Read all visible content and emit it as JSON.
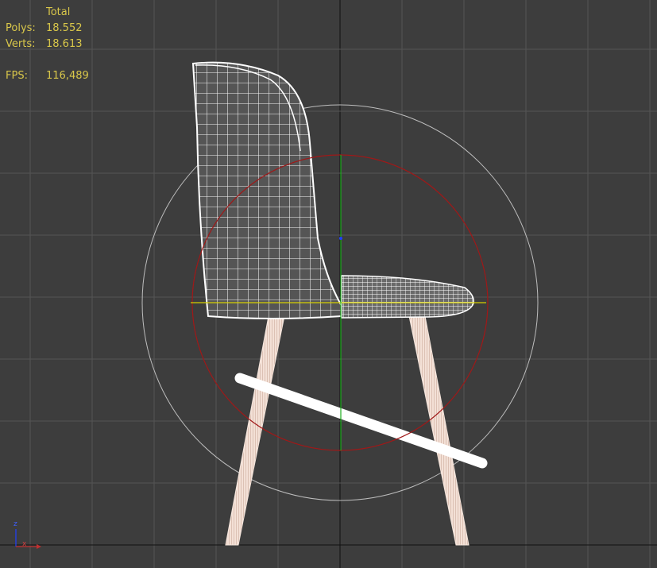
{
  "stats": {
    "header": "Total",
    "rows": [
      {
        "label": "Polys:",
        "value": "18.552"
      },
      {
        "label": "Verts:",
        "value": "18.613"
      }
    ],
    "fps_label": "FPS:",
    "fps_value": "116,489"
  },
  "axis_gizmo": {
    "z_label": "z",
    "x_label": "x"
  },
  "colors": {
    "background": "#3d3d3d",
    "grid": "#555555",
    "grid_axis": "#111111",
    "wireframe": "#ffffff",
    "stats_text": "#d9c74a",
    "rotate_gizmo_outer": "#bdbdbd",
    "rotate_gizmo_inner": "#a01818",
    "gizmo_x": "#d6d000",
    "gizmo_y": "#1fae1f",
    "gizmo_z": "#2040ff"
  }
}
